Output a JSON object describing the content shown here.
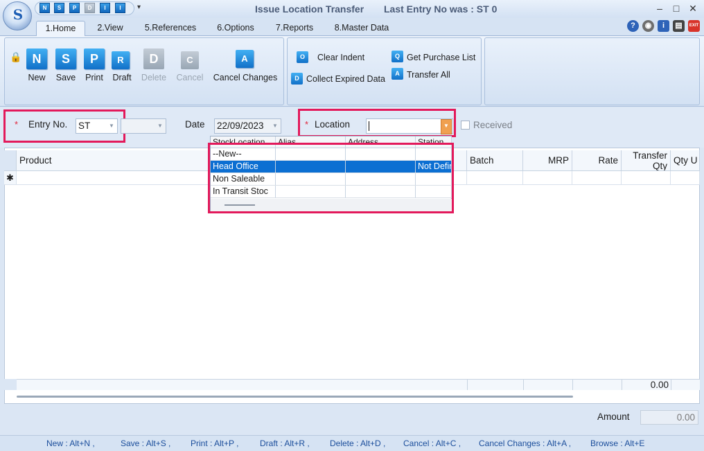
{
  "window": {
    "title": "Issue Location Transfer",
    "last_entry": "Last Entry No was : ST 0",
    "logo_letter": "S",
    "controls": {
      "minimize": "–",
      "maximize": "□",
      "close": "✕"
    }
  },
  "quick_access": [
    "N",
    "S",
    "P",
    "D",
    "I",
    "I"
  ],
  "tabs": [
    "1.Home",
    "2.View",
    "5.References",
    "6.Options",
    "7.Reports",
    "8.Master Data"
  ],
  "help_icons": [
    "?",
    "◉",
    "i",
    "▤",
    "EXIT"
  ],
  "ribbon": {
    "buttons": [
      {
        "label": "New",
        "icon": "N",
        "enabled": true
      },
      {
        "label": "Save",
        "icon": "S",
        "enabled": true
      },
      {
        "label": "Print",
        "icon": "P",
        "enabled": true
      },
      {
        "label": "Draft",
        "icon": "R",
        "enabled": true
      },
      {
        "label": "Delete",
        "icon": "D",
        "enabled": false
      },
      {
        "label": "Cancel",
        "icon": "C",
        "enabled": false
      },
      {
        "label": "Cancel Changes",
        "icon": "A",
        "enabled": true
      }
    ],
    "small_buttons": [
      {
        "label": "Clear Indent",
        "icon": "O"
      },
      {
        "label": "Collect Expired Data",
        "icon": "D"
      },
      {
        "label": "Get Purchase List",
        "icon": "Q"
      },
      {
        "label": "Transfer All",
        "icon": "A"
      }
    ]
  },
  "form": {
    "entry_no_label": "Entry No.",
    "entry_no_value": "ST",
    "date_label": "Date",
    "date_value": "22/09/2023",
    "location_label": "Location",
    "location_value": "",
    "received_label": "Received",
    "required_mark": "*"
  },
  "grid": {
    "columns": [
      "Product",
      "Batch",
      "MRP",
      "Rate",
      "Transfer Qty",
      "Qty U"
    ],
    "new_row_marker": "✱",
    "total_transfer_qty": "0.00"
  },
  "location_dropdown": {
    "columns": [
      "StockLocation",
      "Alias",
      "Address",
      "Station"
    ],
    "rows": [
      {
        "name": "--New--",
        "alias": "",
        "address": "",
        "station": "",
        "selected": false
      },
      {
        "name": "Head Office",
        "alias": "",
        "address": "",
        "station": "Not Defined",
        "selected": true
      },
      {
        "name": "Non Saleable",
        "alias": "",
        "address": "",
        "station": "",
        "selected": false
      },
      {
        "name": "In Transit Stoc",
        "alias": "",
        "address": "",
        "station": "",
        "selected": false
      }
    ]
  },
  "amount": {
    "label": "Amount",
    "value": "0.00"
  },
  "shortcuts": [
    "New : Alt+N ,",
    "Save : Alt+S ,",
    "Print : Alt+P ,",
    "Draft : Alt+R ,",
    "Delete : Alt+D ,",
    "Cancel : Alt+C ,",
    "Cancel Changes : Alt+A ,",
    "Browse : Alt+E"
  ],
  "colors": {
    "accent": "#1170c8",
    "highlight": "#e3195b",
    "selection": "#0c6fd2"
  }
}
